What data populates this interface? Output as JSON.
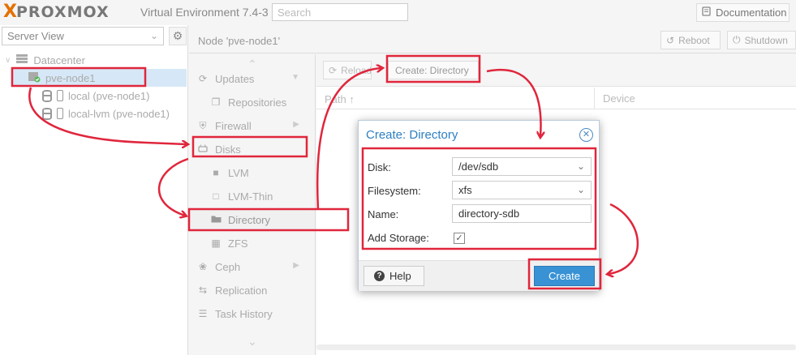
{
  "header": {
    "logo_text": "PROXMOX",
    "version": "Virtual Environment 7.4-3",
    "search_placeholder": "Search",
    "documentation_label": "Documentation"
  },
  "tree": {
    "view_label": "Server View",
    "items": [
      {
        "label": "Datacenter",
        "icon": "datacenter-icon"
      },
      {
        "label": "pve-node1",
        "icon": "server-online-icon"
      },
      {
        "label": "local (pve-node1)",
        "icon": "storage-icon"
      },
      {
        "label": "local-lvm (pve-node1)",
        "icon": "storage-icon"
      }
    ]
  },
  "node_header": {
    "title": "Node 'pve-node1'",
    "reboot_label": "Reboot",
    "shutdown_label": "Shutdown"
  },
  "node_menu": {
    "items": [
      {
        "label": "Updates",
        "icon": "refresh-icon"
      },
      {
        "label": "Repositories",
        "icon": "files-icon"
      },
      {
        "label": "Firewall",
        "icon": "shield-icon"
      },
      {
        "label": "Disks",
        "icon": "hdd-icon"
      },
      {
        "label": "LVM",
        "icon": "square-icon"
      },
      {
        "label": "LVM-Thin",
        "icon": "square-outline-icon"
      },
      {
        "label": "Directory",
        "icon": "folder-icon"
      },
      {
        "label": "ZFS",
        "icon": "th-large-icon"
      },
      {
        "label": "Ceph",
        "icon": "ceph-icon"
      },
      {
        "label": "Replication",
        "icon": "retweet-icon"
      },
      {
        "label": "Task History",
        "icon": "list-alt-icon"
      }
    ]
  },
  "toolbar": {
    "reload_label": "Reload",
    "create_directory_label": "Create: Directory"
  },
  "grid": {
    "columns": [
      "Path",
      "Device"
    ]
  },
  "dialog": {
    "title": "Create: Directory",
    "disk_label": "Disk:",
    "disk_value": "/dev/sdb",
    "filesystem_label": "Filesystem:",
    "filesystem_value": "xfs",
    "name_label": "Name:",
    "name_value": "directory-sdb",
    "add_storage_label": "Add Storage:",
    "add_storage_checked": true,
    "help_label": "Help",
    "create_label": "Create"
  },
  "colors": {
    "brand_orange": "#e57000",
    "accent_blue": "#3892d4",
    "annotation_red": "#e0263c"
  }
}
